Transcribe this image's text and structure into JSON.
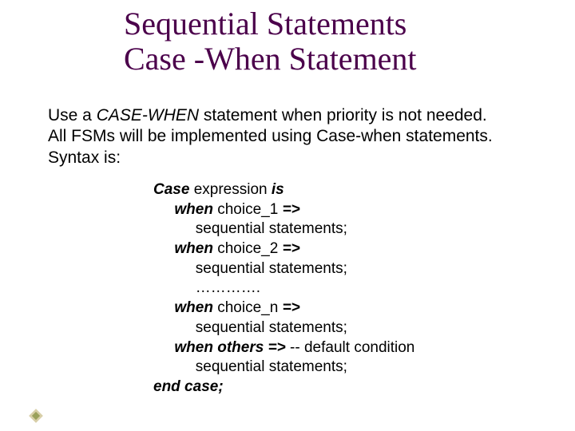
{
  "title": {
    "line1": "Sequential Statements",
    "line2": "Case -When Statement"
  },
  "intro": {
    "l1a": "Use a ",
    "l1b": "CASE-WHEN",
    "l1c": " statement when priority is not needed.",
    "l2": "All FSMs will be implemented using Case-when statements.",
    "l3": "Syntax is:"
  },
  "code": {
    "l1a": "Case",
    "l1b": " expression ",
    "l1c": "is",
    "l2a": "     when",
    "l2b": " choice_1 ",
    "l2c": "=>",
    "l3": "          sequential statements;",
    "l4a": "     when",
    "l4b": " choice_2 ",
    "l4c": "=>",
    "l5": "          sequential statements;",
    "l6": "          ………….",
    "l7a": "     when",
    "l7b": " choice_n ",
    "l7c": "=>",
    "l8": "          sequential statements;",
    "l9a": "     when others =>",
    "l9b": " -- default condition",
    "l10": "          sequential statements;",
    "l11": "end case;"
  }
}
